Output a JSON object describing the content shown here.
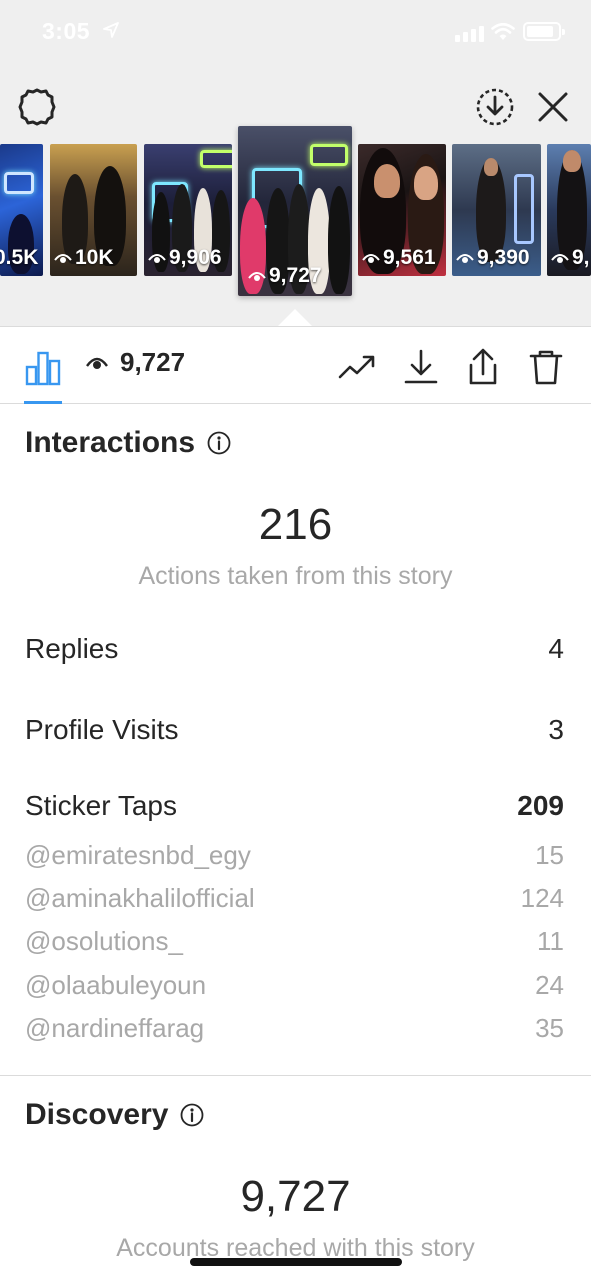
{
  "status_bar": {
    "time": "3:05"
  },
  "header": {
    "icons": [
      "settings-icon",
      "save-icon",
      "close-icon"
    ]
  },
  "story_strip": [
    {
      "views": "0.5K"
    },
    {
      "views": "10K"
    },
    {
      "views": "9,906"
    },
    {
      "views": "9,727",
      "selected": true
    },
    {
      "views": "9,561"
    },
    {
      "views": "9,390"
    },
    {
      "views": "9,"
    }
  ],
  "toolbar": {
    "view_count": "9,727",
    "accent_color": "#3897f0",
    "icons": [
      "insights-icon",
      "eye-icon",
      "promote-icon",
      "download-icon",
      "share-icon",
      "delete-icon"
    ]
  },
  "interactions": {
    "title": "Interactions",
    "total": "216",
    "caption": "Actions taken from this story",
    "metrics": [
      {
        "label": "Replies",
        "value": "4"
      },
      {
        "label": "Profile Visits",
        "value": "3"
      }
    ],
    "sticker_taps": {
      "label": "Sticker Taps",
      "value": "209",
      "items": [
        {
          "label": "@emiratesnbd_egy",
          "value": "15"
        },
        {
          "label": "@aminakhalilofficial",
          "value": "124"
        },
        {
          "label": "@osolutions_",
          "value": "11"
        },
        {
          "label": "@olaabuleyoun",
          "value": "24"
        },
        {
          "label": "@nardineffarag",
          "value": "35"
        }
      ]
    }
  },
  "discovery": {
    "title": "Discovery",
    "total": "9,727",
    "caption": "Accounts reached with this story"
  }
}
